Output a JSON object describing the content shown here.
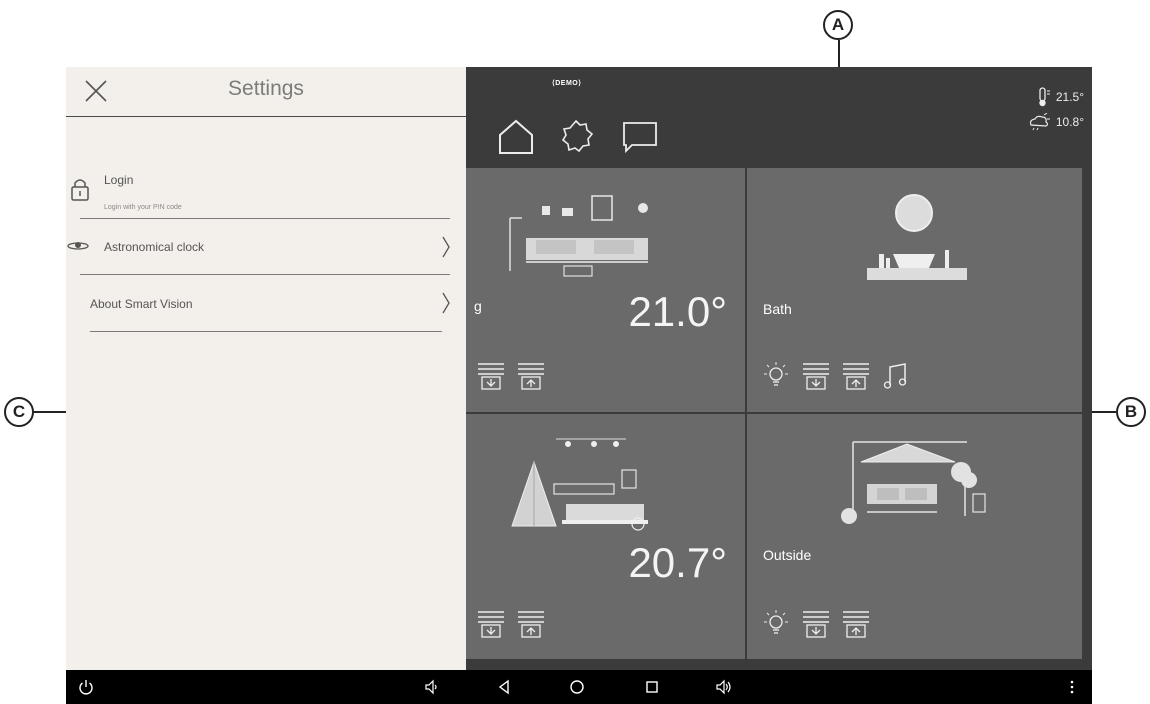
{
  "callouts": {
    "a": "A",
    "b": "B",
    "c": "C"
  },
  "topbar": {
    "demo_label": "⟨DEMO⟩",
    "indoor_temp": "21.5°",
    "outdoor_temp": "10.8°"
  },
  "settings": {
    "title": "Settings",
    "items": [
      {
        "label": "Login",
        "sublabel": "Login with your PIN code"
      },
      {
        "label": "Astronomical clock"
      },
      {
        "label": "About Smart Vision"
      }
    ]
  },
  "rooms": [
    {
      "name": "g",
      "temp": "21.0°"
    },
    {
      "name": "Bath",
      "temp": ""
    },
    {
      "name": "",
      "temp": "20.7°"
    },
    {
      "name": "Outside",
      "temp": ""
    }
  ],
  "colors": {
    "screen_bg": "#3b3b3b",
    "tile_bg": "#6a6a6a",
    "settings_bg": "#f3efeb",
    "sysbar_bg": "#000000"
  },
  "icons": {
    "topbar": [
      "home-icon",
      "gear-icon",
      "chat-icon",
      "thermometer-icon",
      "weather-icon"
    ],
    "tiles": [
      "blind-down-icon",
      "blind-up-icon",
      "light-icon",
      "music-icon"
    ],
    "system": [
      "power-icon",
      "volume-down-icon",
      "back-icon",
      "home-circle-icon",
      "recents-icon",
      "volume-up-icon",
      "more-icon"
    ]
  }
}
